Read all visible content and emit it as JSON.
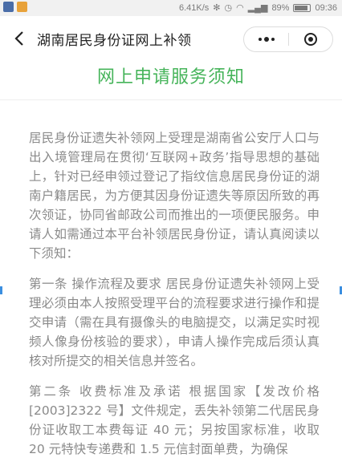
{
  "status_bar": {
    "network_speed": "6.41K/s",
    "battery_percent": "89%",
    "battery_level": 0.89,
    "time": "09:36"
  },
  "nav": {
    "title": "湖南居民身份证网上补领"
  },
  "heading": "网上申请服务须知",
  "paragraphs": [
    "居民身份证遗失补领网上受理是湖南省公安厅人口与出入境管理局在贯彻‘互联网+政务’指导思想的基础上，针对已经申领过登记了指纹信息居民身份证的湖南户籍居民，为方便其因身份证遗失等原因所致的再次领证，协同省邮政公司而推出的一项便民服务。申请人如需通过本平台补领居民身份证，请认真阅读以下须知：",
    "第一条 操作流程及要求 居民身份证遗失补领网上受理必须由本人按照受理平台的流程要求进行操作和提交申请（需在具有摄像头的电脑提交，以满足实时视频人像身份核验的要求），申请人操作完成后须认真核对所提交的相关信息并签名。",
    "第二条 收费标准及承诺 根据国家【发改价格[2003]2322 号】文件规定，丢失补领第二代居民身份证收取工本费每证 40 元；另按国家标准，收取 20 元特快专递费和 1.5 元信封面单费，为确保"
  ],
  "colors": {
    "heading": "#46b45a",
    "body_text": "#8a8a8a",
    "title_text": "#222222"
  }
}
